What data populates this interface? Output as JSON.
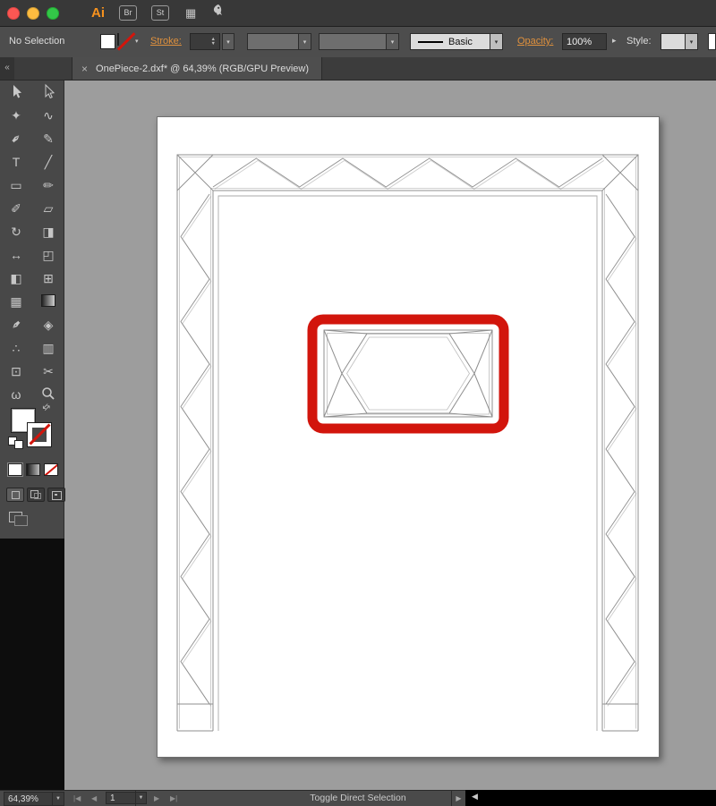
{
  "titlebar": {
    "logo": "Ai",
    "bridge_label": "Br",
    "stock_label": "St"
  },
  "control_bar": {
    "selection_status": "No Selection",
    "stroke_label": "Stroke:",
    "line_style_value": "Basic",
    "opacity_label": "Opacity:",
    "opacity_value": "100%",
    "opacity_flyout": "▸",
    "style_label": "Style:"
  },
  "tab": {
    "close_glyph": "×",
    "collapse_glyph": "«",
    "title": "OnePiece-2.dxf* @ 64,39% (RGB/GPU Preview)"
  },
  "toolbar": {
    "tools": [
      {
        "name": "selection-tool",
        "glyph": "svg-arrow-filled"
      },
      {
        "name": "direct-selection-tool",
        "glyph": "svg-arrow-outline"
      },
      {
        "name": "magic-wand-tool",
        "glyph": "✦"
      },
      {
        "name": "lasso-tool",
        "glyph": "∿"
      },
      {
        "name": "pen-tool",
        "glyph": "✒",
        "rot": -45
      },
      {
        "name": "curvature-tool",
        "glyph": "✎"
      },
      {
        "name": "type-tool",
        "glyph": "T"
      },
      {
        "name": "line-segment-tool",
        "glyph": "╱"
      },
      {
        "name": "rectangle-tool",
        "glyph": "▭"
      },
      {
        "name": "paintbrush-tool",
        "glyph": "✏"
      },
      {
        "name": "shaper-tool",
        "glyph": "✐"
      },
      {
        "name": "eraser-tool",
        "glyph": "▱"
      },
      {
        "name": "rotate-tool",
        "glyph": "↻"
      },
      {
        "name": "scale-tool",
        "glyph": "◨"
      },
      {
        "name": "width-tool",
        "glyph": "↔"
      },
      {
        "name": "free-transform-tool",
        "glyph": "◰"
      },
      {
        "name": "shape-builder-tool",
        "glyph": "◧"
      },
      {
        "name": "perspective-grid-tool",
        "glyph": "⊞"
      },
      {
        "name": "mesh-tool",
        "glyph": "▦"
      },
      {
        "name": "gradient-tool",
        "glyph": "gradient-box"
      },
      {
        "name": "eyedropper-tool",
        "glyph": "✒",
        "rot": 135
      },
      {
        "name": "blend-tool",
        "glyph": "◈"
      },
      {
        "name": "symbol-sprayer-tool",
        "glyph": "∴"
      },
      {
        "name": "column-graph-tool",
        "glyph": "▥"
      },
      {
        "name": "artboard-tool",
        "glyph": "⊡"
      },
      {
        "name": "slice-tool",
        "glyph": "✂"
      },
      {
        "name": "hand-tool",
        "glyph": "ω"
      },
      {
        "name": "zoom-tool",
        "glyph": "svg-zoom"
      }
    ]
  },
  "statusbar": {
    "zoom_value": "64,39%",
    "first_glyph": "|◀",
    "prev_glyph": "◀",
    "page_value": "1",
    "next_glyph": "▶",
    "last_glyph": "▶|",
    "status_text": "Toggle Direct Selection",
    "flyout_glyph": "▶",
    "collapsed_glyph": "◀"
  },
  "colors": {
    "artwork_red": "#d2150c",
    "label_orange": "#e0913d",
    "logo_orange": "#f7921e",
    "canvas_gray": "#9d9d9d"
  }
}
